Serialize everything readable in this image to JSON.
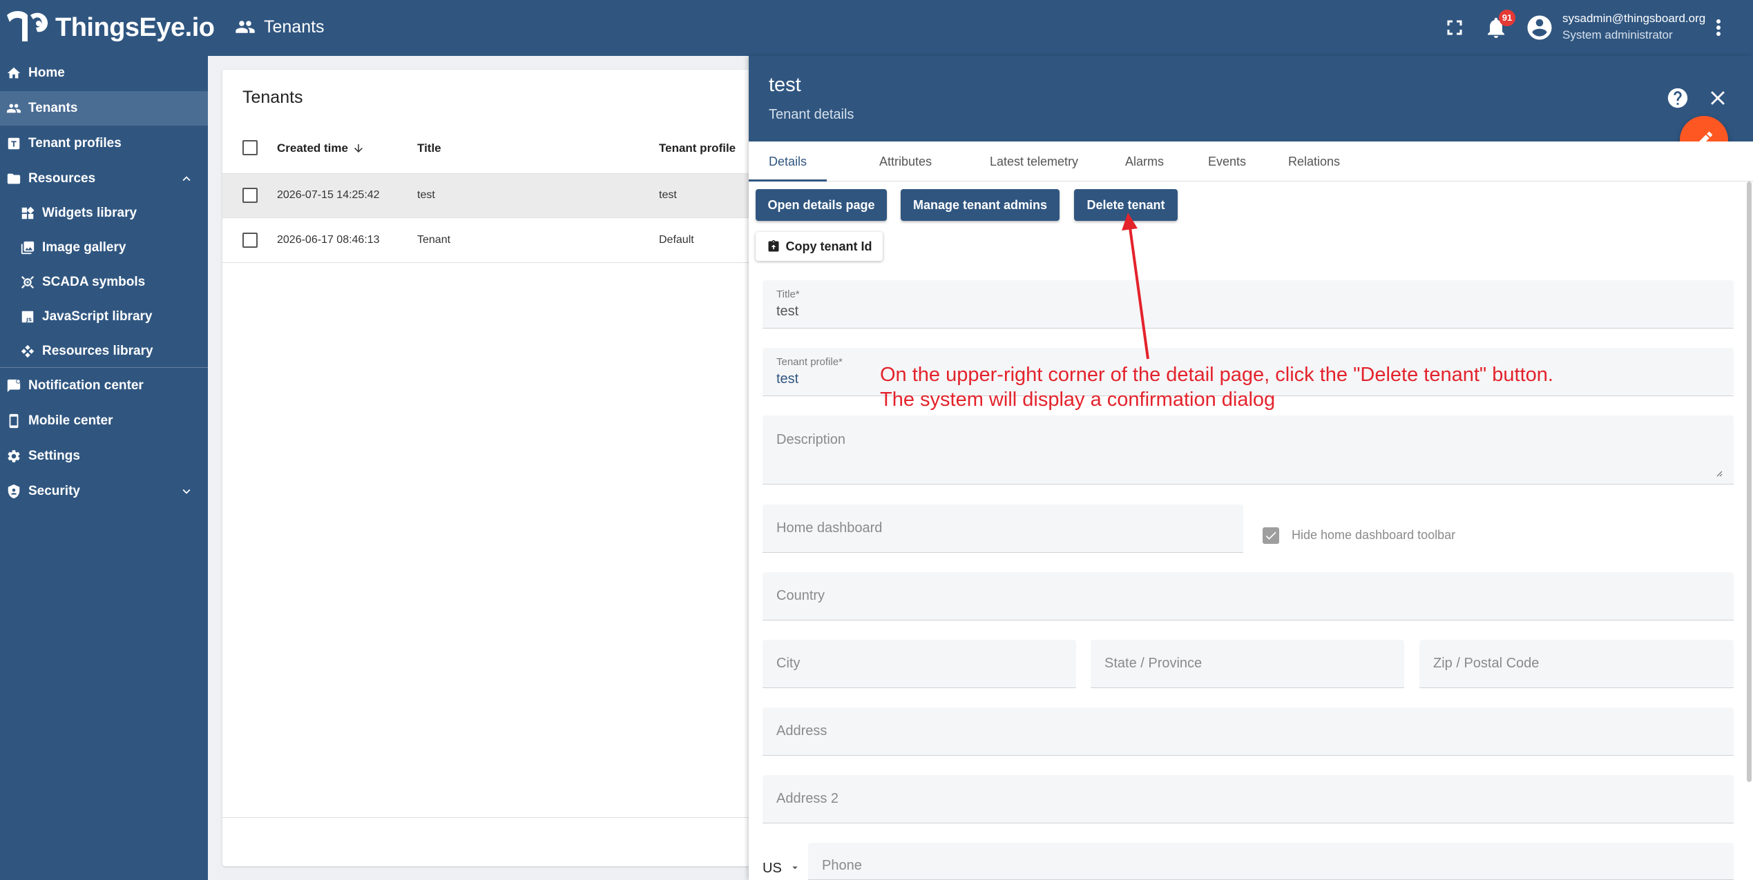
{
  "app": {
    "logo_text": "ThingsEye.io",
    "page_title": "Tenants",
    "notification_count": "91",
    "user_email": "sysadmin@thingsboard.org",
    "user_role": "System administrator",
    "brand_color": "#305680",
    "accent_color": "#ff5722"
  },
  "sidebar": {
    "items": [
      {
        "label": "Home",
        "icon": "home-icon"
      },
      {
        "label": "Tenants",
        "icon": "people-icon",
        "active": true
      },
      {
        "label": "Tenant profiles",
        "icon": "tenant-profile-icon"
      },
      {
        "label": "Resources",
        "icon": "folder-icon",
        "expanded": true
      },
      {
        "label": "Widgets library",
        "icon": "widgets-icon"
      },
      {
        "label": "Image gallery",
        "icon": "image-icon"
      },
      {
        "label": "SCADA symbols",
        "icon": "scada-icon"
      },
      {
        "label": "JavaScript library",
        "icon": "javascript-icon"
      },
      {
        "label": "Resources library",
        "icon": "resources-library-icon"
      },
      {
        "label": "Notification center",
        "icon": "notification-icon"
      },
      {
        "label": "Mobile center",
        "icon": "mobile-icon"
      },
      {
        "label": "Settings",
        "icon": "gear-icon"
      },
      {
        "label": "Security",
        "icon": "shield-icon",
        "expanded": false
      }
    ]
  },
  "table": {
    "title": "Tenants",
    "columns": [
      "Created time",
      "Title",
      "Tenant profile"
    ],
    "rows": [
      {
        "created": "2026-07-15 14:25:42",
        "title": "test",
        "profile": "test",
        "selected": true
      },
      {
        "created": "2026-06-17 08:46:13",
        "title": "Tenant",
        "profile": "Default",
        "selected": false
      }
    ]
  },
  "detail": {
    "title": "test",
    "subtitle": "Tenant details",
    "tabs": [
      "Details",
      "Attributes",
      "Latest telemetry",
      "Alarms",
      "Events",
      "Relations"
    ],
    "buttons": {
      "open_details": "Open details page",
      "manage_admins": "Manage tenant admins",
      "delete_tenant": "Delete tenant",
      "copy_id": "Copy tenant Id"
    },
    "fields": {
      "title_label": "Title*",
      "title_value": "test",
      "profile_label": "Tenant profile*",
      "profile_value": "test",
      "description": "Description",
      "home_dashboard": "Home dashboard",
      "hide_toolbar": "Hide home dashboard toolbar",
      "country": "Country",
      "city": "City",
      "state": "State / Province",
      "zip": "Zip / Postal Code",
      "address": "Address",
      "address2": "Address 2",
      "phone_country": "US",
      "phone": "Phone"
    }
  },
  "annotation": {
    "line1": "On the upper-right corner of the detail page, click the \"Delete tenant\" button.",
    "line2": "The system will display a confirmation dialog",
    "color": "#e3232c"
  }
}
